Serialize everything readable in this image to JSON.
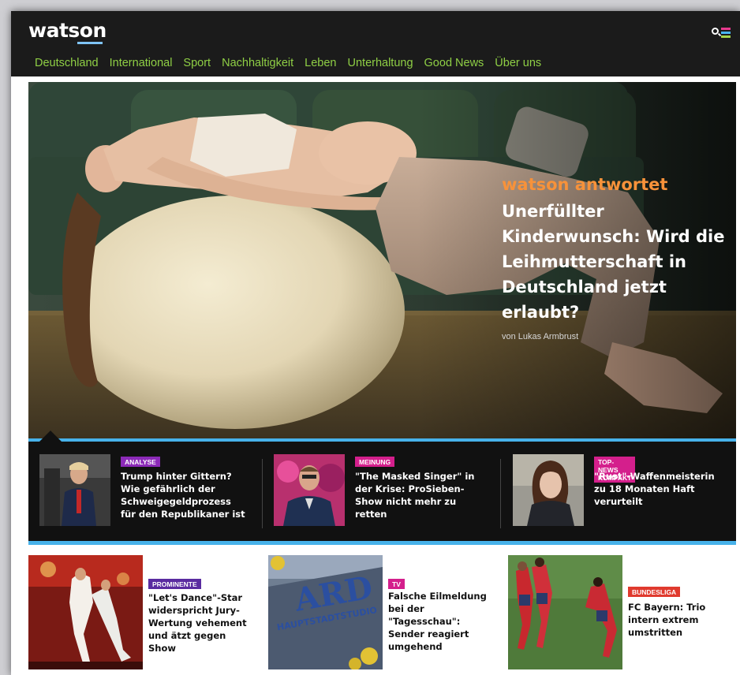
{
  "header": {
    "logo": "watson",
    "menu_icon": "search-menu-icon",
    "nav": [
      "Deutschland",
      "International",
      "Sport",
      "Nachhaltigkeit",
      "Leben",
      "Unterhaltung",
      "Good News",
      "Über uns"
    ]
  },
  "hero": {
    "kicker": "watson antwortet",
    "title": "Unerfüllter Kinderwunsch: Wird die Leihmutterschaft in Deutschland jetzt erlaubt?",
    "author": "von Lukas Armbrust"
  },
  "teasers": [
    {
      "tag": "ANALYSE",
      "tag_color": "#8c2ab8",
      "title": "Trump hinter Gittern? Wie gefährlich der Schweigegeldprozess für den Republikaner ist"
    },
    {
      "tag": "MEINUNG",
      "tag_color": "#d41f8c",
      "title": "\"The Masked Singer\" in der Krise: ProSieben-Show nicht mehr zu retten"
    },
    {
      "tag": "TOP-NEWS KOMPAKT",
      "tag_color": "#d41f8c",
      "title": "\"Rust\"-Waffenmeisterin zu 18 Monaten Haft verurteilt"
    }
  ],
  "cards": [
    {
      "tag": "PROMINENTE",
      "tag_color": "#5a2ca0",
      "title": "\"Let's Dance\"-Star widerspricht Jury-Wertung vehement und ätzt gegen Show"
    },
    {
      "tag": "TV",
      "tag_color": "#d41f8c",
      "title": "Falsche Eilmeldung bei der \"Tagesschau\": Sender reagiert umgehend"
    },
    {
      "tag": "BUNDESLIGA",
      "tag_color": "#e03a2e",
      "title": "FC Bayern: Trio intern extrem umstritten"
    }
  ],
  "image_text": {
    "ard_sign": "ARD",
    "ard_subsign": "HAUPTSTADTSTUDIO"
  }
}
